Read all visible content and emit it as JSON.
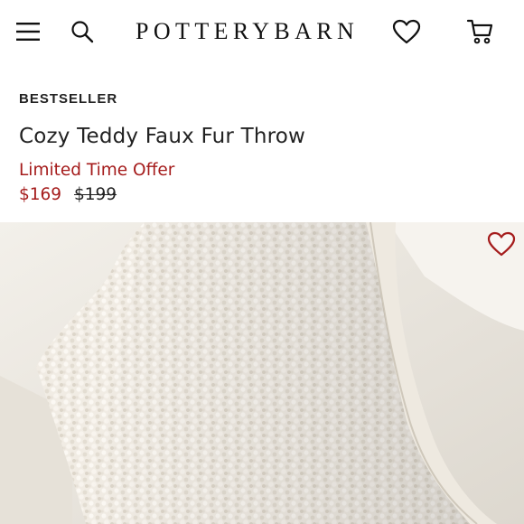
{
  "header": {
    "logo_text": "POTTERYBARN",
    "icons": {
      "menu": "hamburger-menu-icon",
      "search": "search-icon",
      "favorites": "heart-icon",
      "cart": "cart-icon"
    }
  },
  "product": {
    "badge": "BESTSELLER",
    "title": "Cozy Teddy Faux Fur Throw",
    "offer": "Limited Time Offer",
    "price_sale": "$169",
    "price_original": "$199"
  },
  "colors": {
    "sale_red": "#a51c1c",
    "text": "#222222",
    "throw_cream": "#f3efe8",
    "sofa_white": "#ebe7e0"
  }
}
